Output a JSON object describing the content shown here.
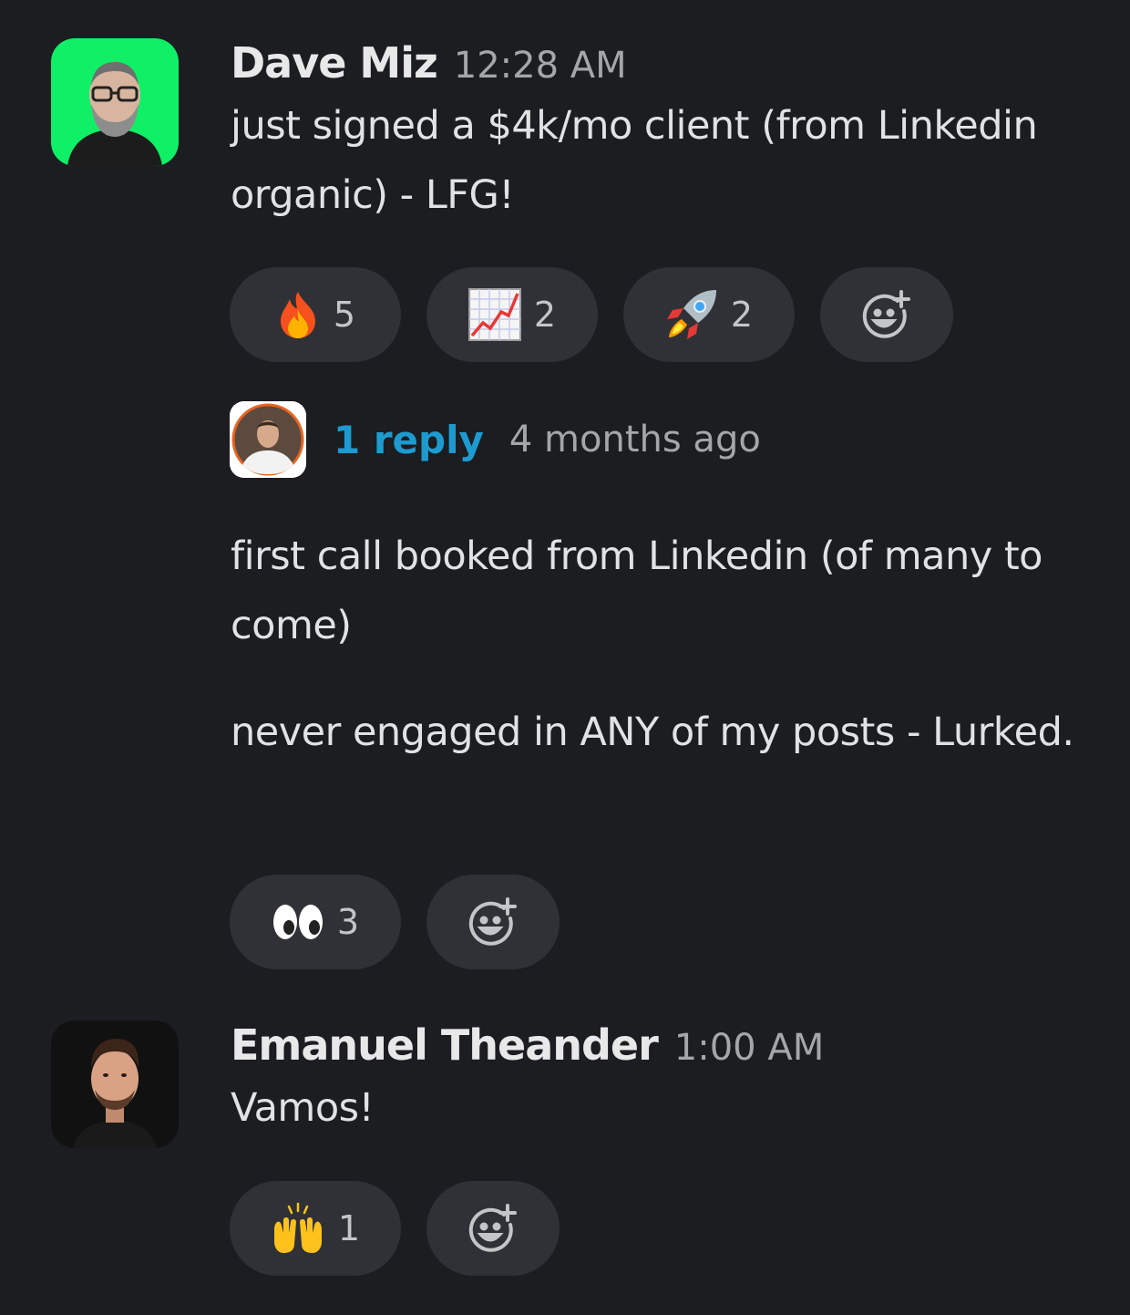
{
  "messages": [
    {
      "author": "Dave Miz",
      "time": "12:28 AM",
      "text": "just signed a $4k/mo client (from Linkedin organic) - LFG!",
      "reactions": [
        {
          "emoji": "fire-emoji",
          "count": "5"
        },
        {
          "emoji": "chart-increasing-emoji",
          "count": "2"
        },
        {
          "emoji": "rocket-emoji",
          "count": "2"
        }
      ],
      "thread": {
        "reply_label": "1 reply",
        "last_reply": "4 months ago"
      }
    },
    {
      "text": "first call booked from Linkedin (of many to come)"
    },
    {
      "text": "never engaged in ANY of my posts - Lurked.",
      "reactions": [
        {
          "emoji": "eyes-emoji",
          "count": "3"
        }
      ]
    },
    {
      "author": "Emanuel Theander",
      "time": "1:00 AM",
      "text": "Vamos!",
      "reactions": [
        {
          "emoji": "raising-hands-emoji",
          "count": "1"
        }
      ]
    }
  ],
  "colors": {
    "background": "#1b1d21",
    "reaction_pill": "#2f3136",
    "link": "#1d9bd1",
    "avatar_dave_bg": "#0ff066"
  },
  "icons": {
    "add_reaction": "add-reaction-icon"
  }
}
